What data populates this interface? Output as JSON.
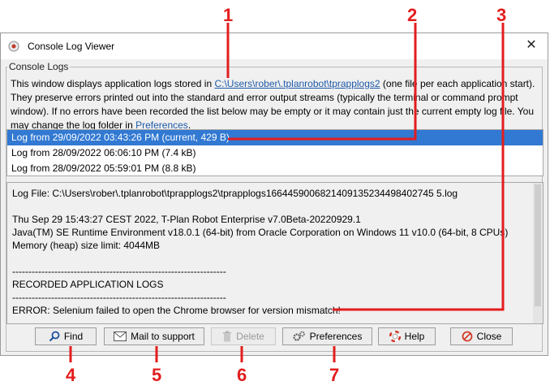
{
  "window": {
    "title": "Console Log Viewer",
    "close_glyph": "✕"
  },
  "group": {
    "legend": "Console Logs"
  },
  "description": {
    "line1_pre": "This window displays application logs stored in ",
    "line1_link": "C:\\Users\\rober\\.tplanrobot\\tprapplogs2",
    "line1_post": " (one file per each application start).",
    "line2": "They preserve errors printed out into the standard and error output streams (typically the terminal or command prompt",
    "line3": "window). If no errors have been recorded the list below may be empty or it may contain just the current empty log file. You",
    "line4_pre": "may change the log folder in ",
    "line4_link": "Preferences",
    "line4_post": "."
  },
  "logs": [
    {
      "label": "Log from 29/09/2022 03:43:26 PM (current, 429 B)",
      "selected": true
    },
    {
      "label": "Log from 28/09/2022 06:06:10 PM (7.4 kB)",
      "selected": false
    },
    {
      "label": "Log from 28/09/2022 05:59:01 PM (8.8 kB)",
      "selected": false
    }
  ],
  "log_content": [
    "Log File: C:\\Users\\rober\\.tplanrobot\\tprapplogs2\\tprapplogs1664459006821409135234498402745 5.log",
    "",
    "Thu Sep 29 15:43:27 CEST 2022, T-Plan Robot Enterprise v7.0Beta-20220929.1",
    "Java(TM) SE Runtime Environment v18.0.1 (64-bit) from Oracle Corporation on Windows 11 v10.0 (64-bit, 8 CPUs)",
    "Memory (heap) size limit: 4044MB",
    "",
    "------------------------------------------------------------------",
    "RECORDED APPLICATION LOGS",
    "------------------------------------------------------------------",
    "ERROR: Selenium failed to open the Chrome browser for version mismatch!"
  ],
  "buttons": {
    "find": "Find",
    "mail": "Mail to support",
    "delete": "Delete",
    "preferences": "Preferences",
    "help": "Help",
    "close": "Close"
  },
  "annotations": [
    "1",
    "2",
    "3",
    "4",
    "5",
    "6",
    "7"
  ],
  "colors": {
    "annotation": "#e31d1d",
    "selection": "#3179d2",
    "link": "#1e5aa8"
  }
}
